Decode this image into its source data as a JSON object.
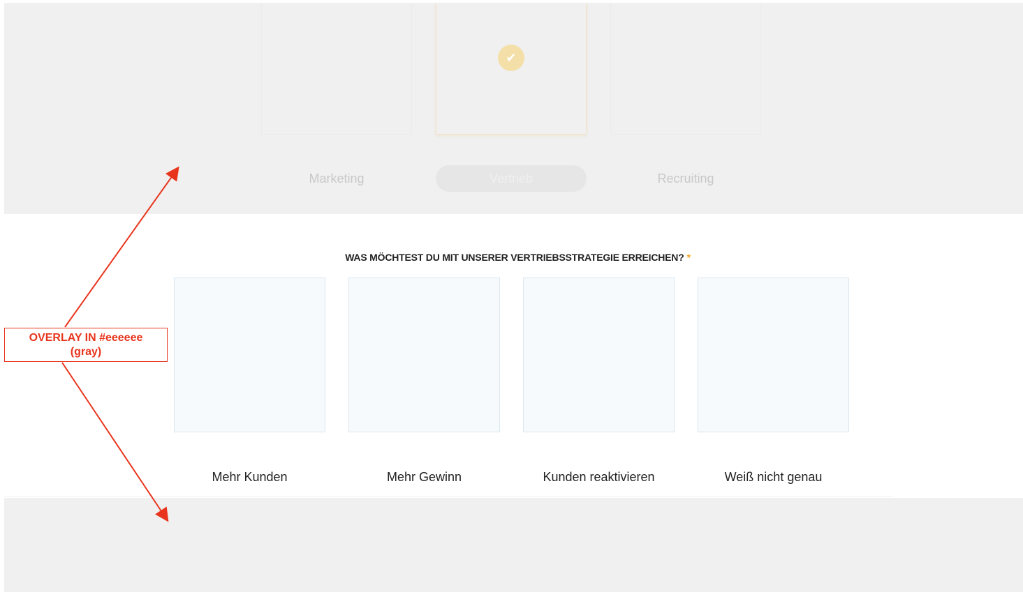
{
  "top_tabs": [
    {
      "label": "Marketing",
      "selected": false
    },
    {
      "label": "Vertrieb",
      "selected": true
    },
    {
      "label": "Recruiting",
      "selected": false
    }
  ],
  "check_icon": "✔",
  "question": {
    "text": "WAS MÖCHTEST DU MIT UNSERER VERTRIEBSSTRATEGIE ERREICHEN?",
    "required_mark": "*"
  },
  "options": [
    {
      "label": "Mehr Kunden"
    },
    {
      "label": "Mehr Gewinn"
    },
    {
      "label": "Kunden reaktivieren"
    },
    {
      "label": "Weiß nicht genau"
    }
  ],
  "annotation": {
    "line1": "OVERLAY IN #eeeeee",
    "line2": "(gray)",
    "color": "#e8341c"
  },
  "colors": {
    "overlay": "#f0f0f0",
    "accent": "#f5a623",
    "option_bg": "#f6fafd"
  }
}
